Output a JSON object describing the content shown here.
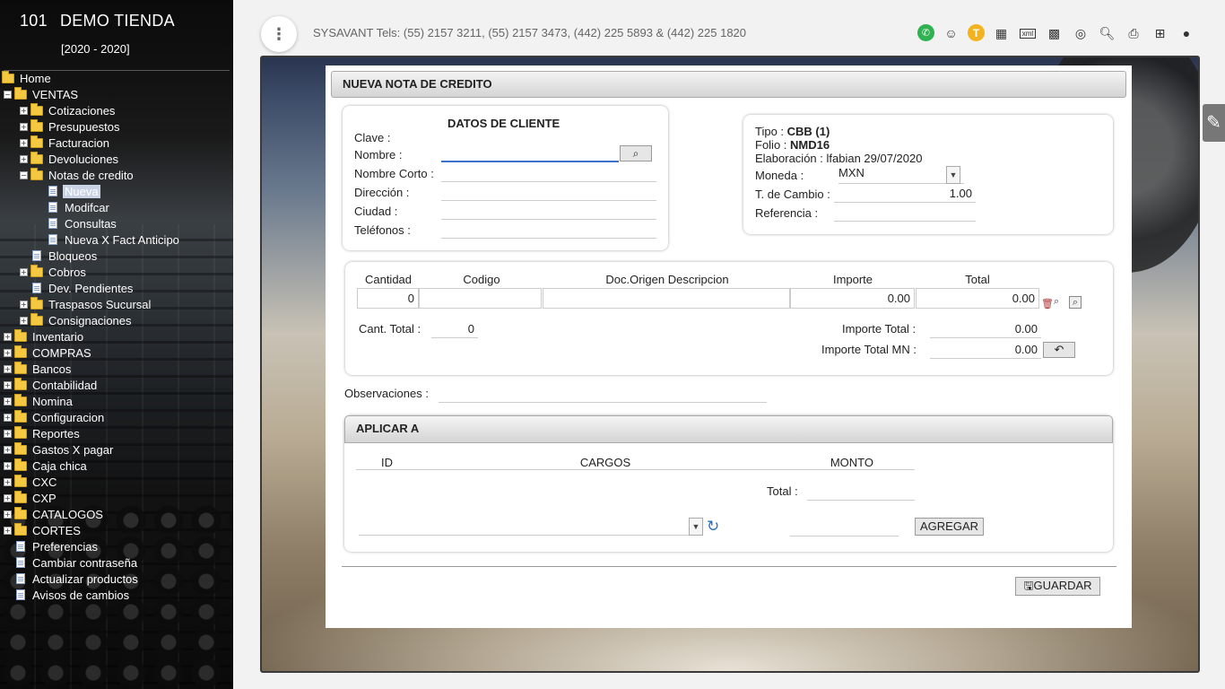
{
  "sidebar": {
    "company_num": "101",
    "company_name": "DEMO TIENDA",
    "years": "[2020 - 2020]",
    "items": [
      {
        "label": "Home"
      },
      {
        "label": "VENTAS"
      },
      {
        "label": "Cotizaciones"
      },
      {
        "label": "Presupuestos"
      },
      {
        "label": "Facturacion"
      },
      {
        "label": "Devoluciones"
      },
      {
        "label": "Notas de credito"
      },
      {
        "label": "Nueva"
      },
      {
        "label": "Modifcar"
      },
      {
        "label": "Consultas"
      },
      {
        "label": "Nueva X Fact Anticipo"
      },
      {
        "label": "Bloqueos"
      },
      {
        "label": "Cobros"
      },
      {
        "label": "Dev. Pendientes"
      },
      {
        "label": "Traspasos Sucursal"
      },
      {
        "label": "Consignaciones"
      },
      {
        "label": "Inventario"
      },
      {
        "label": "COMPRAS"
      },
      {
        "label": "Bancos"
      },
      {
        "label": "Contabilidad"
      },
      {
        "label": "Nomina"
      },
      {
        "label": "Configuracion"
      },
      {
        "label": "Reportes"
      },
      {
        "label": "Gastos X pagar"
      },
      {
        "label": "Caja chica"
      },
      {
        "label": "CXC"
      },
      {
        "label": "CXP"
      },
      {
        "label": "CATALOGOS"
      },
      {
        "label": "CORTES"
      },
      {
        "label": "Preferencias"
      },
      {
        "label": "Cambiar contraseña"
      },
      {
        "label": "Actualizar productos"
      },
      {
        "label": "Avisos de cambios"
      }
    ]
  },
  "topbar": {
    "menu_glyph": "⋮",
    "phones": "SYSAVANT Tels: (55) 2157 3211, (55) 2157 3473, (442) 225 5893 & (442) 225 1820",
    "icons": [
      "whatsapp-icon",
      "support-icon",
      "user-t-icon",
      "dashboard-icon",
      "xml-icon",
      "qr-icon",
      "target-icon",
      "search-report-icon",
      "print-icon",
      "new-window-icon",
      "user-icon"
    ],
    "t_badge": "T",
    "xml_text": "xml"
  },
  "form": {
    "title": "NUEVA NOTA DE CREDITO",
    "cliente": {
      "heading": "DATOS DE CLIENTE",
      "clave_label": "Clave :",
      "nombre_label": "Nombre :",
      "nombre_corto_label": "Nombre Corto :",
      "direccion_label": "Dirección :",
      "ciudad_label": "Ciudad :",
      "telefonos_label": "Teléfonos :",
      "search_glyph": "⌕"
    },
    "doc": {
      "tipo_label": "Tipo :",
      "tipo_value": "CBB (1)",
      "folio_label": "Folio :",
      "folio_value": "NMD16",
      "elaboracion": "Elaboración : lfabian 29/07/2020",
      "moneda_label": "Moneda :",
      "moneda_value": "MXN",
      "tcambio_label": "T. de Cambio :",
      "tcambio_value": "1.00",
      "referencia_label": "Referencia :"
    },
    "items": {
      "headers": [
        "Cantidad",
        "Codigo",
        "Doc.Origen Descripcion",
        "Importe",
        "Total"
      ],
      "cantidad": "0",
      "importe": "0.00",
      "total": "0.00",
      "cant_total_label": "Cant. Total :",
      "cant_total_value": "0",
      "importe_total_label": "Importe Total :",
      "importe_total_value": "0.00",
      "importe_total_mn_label": "Importe Total MN :",
      "importe_total_mn_value": "0.00",
      "undo_glyph": "↶"
    },
    "observaciones_label": "Observaciones :",
    "aplicar": {
      "title": "APLICAR A",
      "headers": [
        "ID",
        "CARGOS",
        "MONTO"
      ],
      "total_label": "Total :",
      "agregar_label": "AGREGAR"
    },
    "guardar_label": "GUARDAR"
  }
}
